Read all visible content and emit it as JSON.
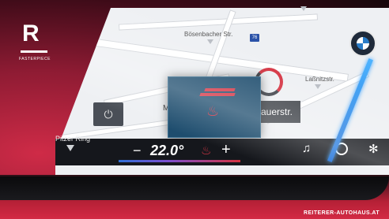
{
  "brand": {
    "letter": "R",
    "name": "FASTERPIECE",
    "website": "REITERER-AUTOHAUS.AT"
  },
  "map": {
    "streets": [
      {
        "name": "Bösenbacher Str."
      },
      {
        "name": "Laßnitzstr."
      },
      {
        "name": "Pitzer Ring"
      }
    ],
    "route_badge": "76",
    "current_street_left": "M",
    "current_street": "auerstr."
  },
  "climate": {
    "minus": "−",
    "temperature": "22.0°",
    "plus": "+"
  },
  "icons": {
    "media": "music-note-icon",
    "navigation": "navigation-icon",
    "fan": "fan-icon",
    "seat_heat": "seat-heat-icon",
    "brand_logo": "bmw-logo-icon"
  },
  "colors": {
    "accent_red": "#d53545",
    "screen_bg": "#eef0f3",
    "popup_bg": "#1e4d6e"
  }
}
